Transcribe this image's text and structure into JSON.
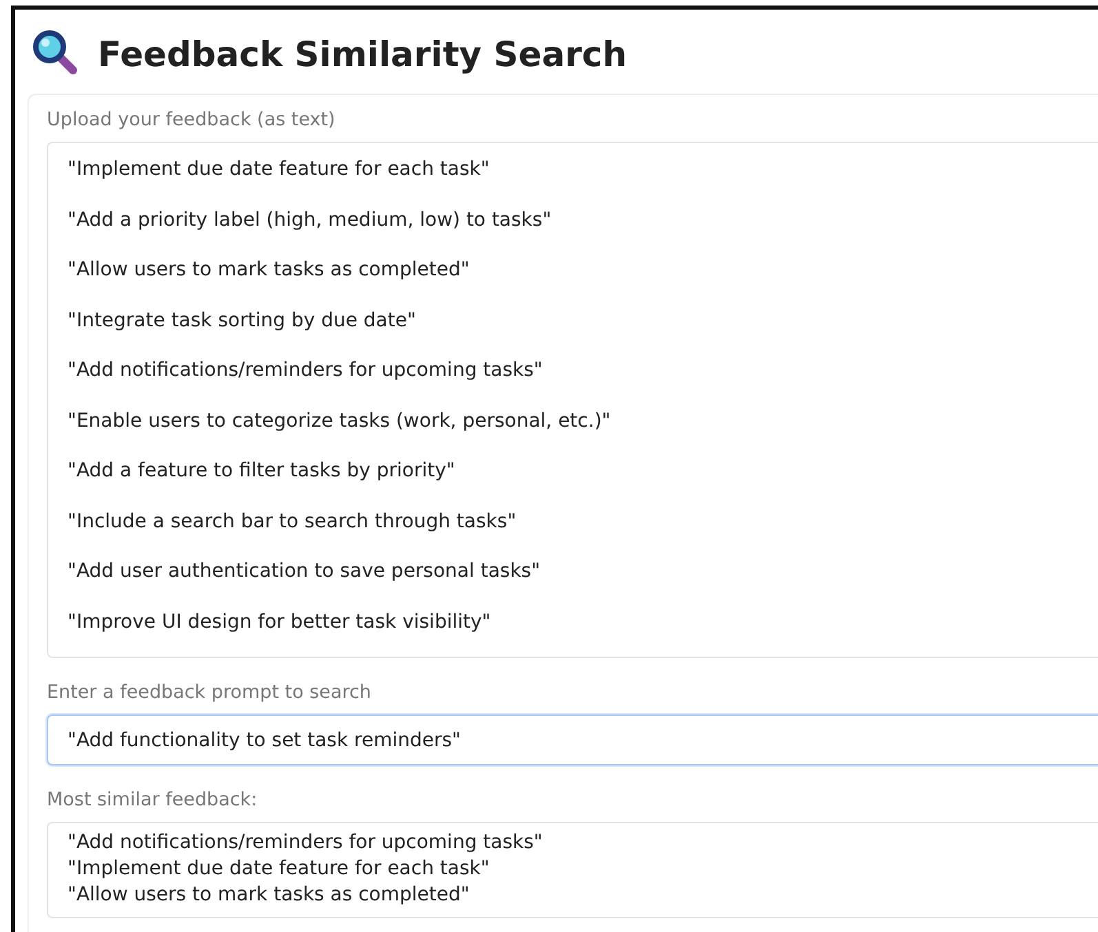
{
  "title": "Feedback Similarity Search",
  "upload": {
    "label": "Upload your feedback (as text)",
    "lines": [
      "\"Implement due date feature for each task\"",
      "\"Add a priority label (high, medium, low) to tasks\"",
      "\"Allow users to mark tasks as completed\"",
      "\"Integrate task sorting by due date\"",
      "\"Add notifications/reminders for upcoming tasks\"",
      "\"Enable users to categorize tasks (work, personal, etc.)\"",
      "\"Add a feature to filter tasks by priority\"",
      "\"Include a search bar to search through tasks\"",
      "\"Add user authentication to save personal tasks\"",
      "\"Improve UI design for better task visibility\""
    ]
  },
  "prompt": {
    "label": "Enter a feedback prompt to search",
    "value": "\"Add functionality to set task reminders\"",
    "focused": true
  },
  "result": {
    "label": "Most similar feedback:",
    "lines": [
      "\"Add notifications/reminders for upcoming tasks\"",
      "\"Implement due date feature for each task\"",
      "\"Allow users to mark tasks as completed\""
    ]
  }
}
